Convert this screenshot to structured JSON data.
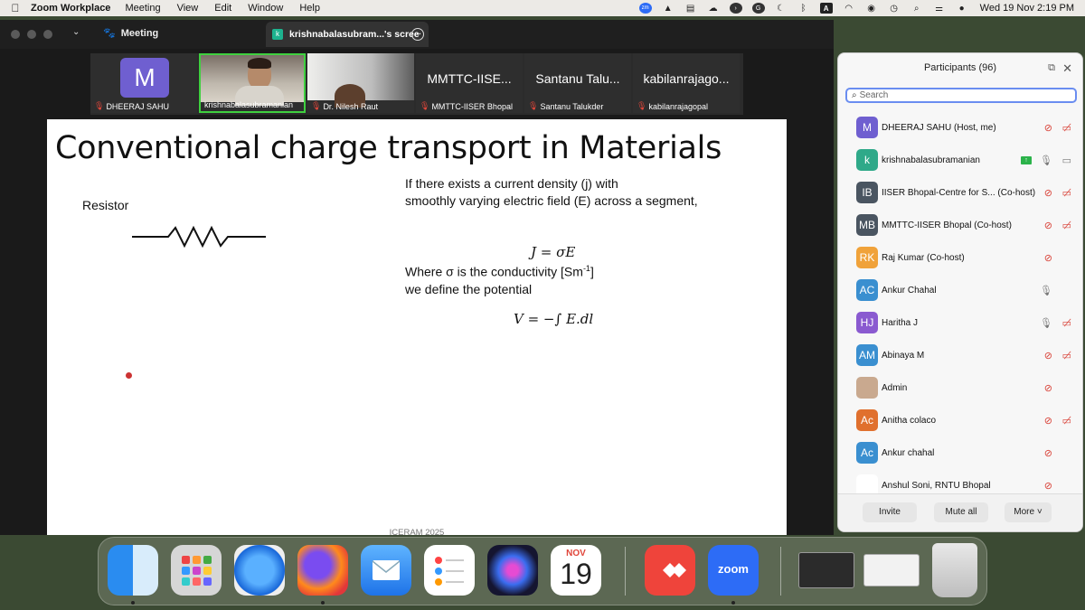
{
  "menubar": {
    "app_name": "Zoom Workplace",
    "items": [
      "Meeting",
      "View",
      "Edit",
      "Window",
      "Help"
    ],
    "clock": "Wed 19 Nov  2:19 PM",
    "status_icons": [
      "zoom-status-icon",
      "drive-icon",
      "printer-icon",
      "cloud-icon",
      "forward-icon",
      "grammarly-icon",
      "moon-icon",
      "bluetooth-icon",
      "input-source-icon",
      "wifi-icon",
      "user-icon",
      "time-machine-icon",
      "search-icon",
      "control-center-icon",
      "siri-icon"
    ],
    "input_source": "A",
    "zoom_status": "zm"
  },
  "window": {
    "meeting_label": "Meeting",
    "share_tab_initial": "k",
    "share_tab_label": "krishnabalasubram...'s scree"
  },
  "strip": {
    "tiles": [
      {
        "name": "DHEERAJ SAHU",
        "avatar": "M",
        "muted": true
      },
      {
        "name": "krishnabalasubramanian",
        "muted": false,
        "active": true
      },
      {
        "name": "Dr. Nilesh Raut",
        "muted": true
      },
      {
        "big": "MMTTC-IISE...",
        "name": "MMTTC-IISER Bhopal",
        "muted": true
      },
      {
        "big": "Santanu Talu...",
        "name": "Santanu Talukder",
        "muted": true
      },
      {
        "big": "kabilanrajago...",
        "name": "kabilanrajagopal",
        "muted": true
      }
    ]
  },
  "slide": {
    "title": "Conventional charge transport in Materials",
    "resistor_label": "Resistor",
    "line1": "If there exists a current density (j) with",
    "line2": "smoothly varying electric field (E) across a segment,",
    "eq1": "J = σE",
    "line3_prefix": "Where σ is the conductivity [Sm",
    "line3_sup": "-1",
    "line3_suffix": "]",
    "line4": " we define the potential",
    "eq2": "V = −∫ E.dl",
    "footer": "ICERAM 2025"
  },
  "participants": {
    "title": "Participants (96)",
    "search_placeholder": "Search",
    "rows": [
      {
        "initials": "M",
        "color": "#6f5fd0",
        "name": "DHEERAJ SAHU (Host, me)",
        "mic": "off",
        "cam": "off"
      },
      {
        "initials": "k",
        "color": "#2fa989",
        "name": "krishnabalasubramanian",
        "mic": "on",
        "cam": "on",
        "sharing": true
      },
      {
        "initials": "IB",
        "color": "#4a5561",
        "name": "IISER Bhopal-Centre for S... (Co-host)",
        "mic": "off",
        "cam": "off"
      },
      {
        "initials": "MB",
        "color": "#4a5561",
        "name": "MMTTC-IISER Bhopal (Co-host)",
        "mic": "off",
        "cam": "off"
      },
      {
        "initials": "RK",
        "color": "#f0a23a",
        "name": "Raj Kumar (Co-host)",
        "mic": "off",
        "cam": ""
      },
      {
        "initials": "AC",
        "color": "#3a8fd0",
        "name": "Ankur Chahal",
        "mic": "on",
        "cam": ""
      },
      {
        "initials": "HJ",
        "color": "#8a5ad0",
        "name": "Haritha J",
        "mic": "on",
        "cam": "off"
      },
      {
        "initials": "AM",
        "color": "#3a8fd0",
        "name": "Abinaya M",
        "mic": "off",
        "cam": "off"
      },
      {
        "initials": "",
        "color": "#c9a98f",
        "name": "Admin",
        "mic": "off",
        "cam": ""
      },
      {
        "initials": "Ac",
        "color": "#e0702e",
        "name": "Anitha colaco",
        "mic": "off",
        "cam": "off"
      },
      {
        "initials": "Ac",
        "color": "#3a8fd0",
        "name": "Ankur chahal",
        "mic": "off",
        "cam": ""
      },
      {
        "initials": "",
        "color": "#ffffff",
        "name": "Anshul Soni, RNTU Bhopal",
        "mic": "off",
        "cam": ""
      }
    ],
    "buttons": {
      "invite": "Invite",
      "mute_all": "Mute all",
      "more": "More"
    }
  },
  "dock": {
    "apps": [
      "finder-icon",
      "launchpad-icon",
      "safari-icon",
      "firefox-icon",
      "mail-icon",
      "reminders-icon",
      "siri-icon",
      "calendar-icon",
      "anydesk-icon",
      "zoom-icon",
      "window-thumbnail",
      "finder-window-thumbnail",
      "trash-icon"
    ],
    "calendar_month": "NOV",
    "calendar_day": "19",
    "zoom_label": "zoom"
  }
}
